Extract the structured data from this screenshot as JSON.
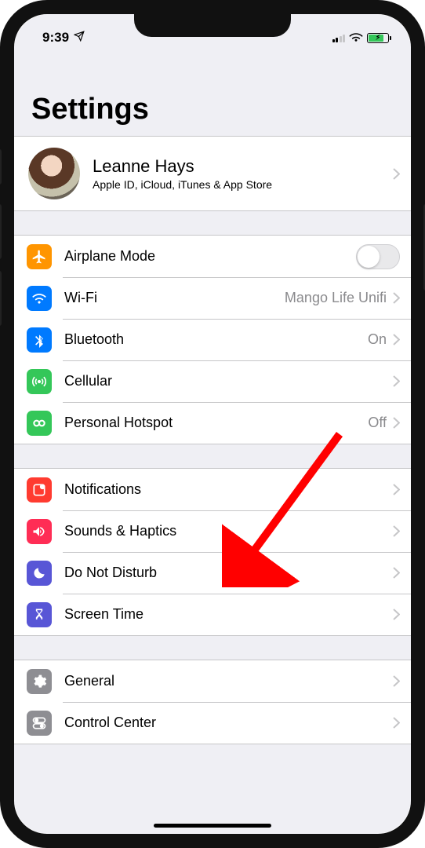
{
  "status": {
    "time": "9:39"
  },
  "title": "Settings",
  "profile": {
    "name": "Leanne Hays",
    "subtitle": "Apple ID, iCloud, iTunes & App Store"
  },
  "group1": {
    "airplane": {
      "label": "Airplane Mode",
      "enabled": false
    },
    "wifi": {
      "label": "Wi-Fi",
      "value": "Mango Life Unifi"
    },
    "bluetooth": {
      "label": "Bluetooth",
      "value": "On"
    },
    "cellular": {
      "label": "Cellular"
    },
    "hotspot": {
      "label": "Personal Hotspot",
      "value": "Off"
    }
  },
  "group2": {
    "notifications": {
      "label": "Notifications"
    },
    "sounds": {
      "label": "Sounds & Haptics"
    },
    "dnd": {
      "label": "Do Not Disturb"
    },
    "screentime": {
      "label": "Screen Time"
    }
  },
  "group3": {
    "general": {
      "label": "General"
    },
    "control": {
      "label": "Control Center"
    }
  },
  "annotation": {
    "target": "sounds-haptics-row"
  }
}
